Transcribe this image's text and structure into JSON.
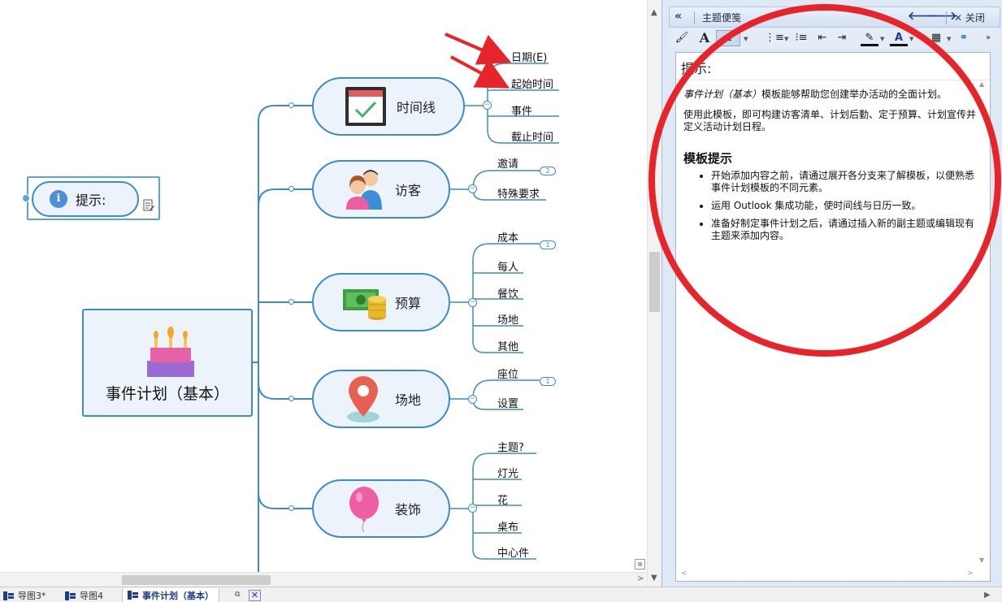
{
  "map": {
    "central": {
      "label": "事件计划（基本）",
      "icon": "birthday-cake-icon"
    },
    "tip": {
      "label": "提示:",
      "icon": "info-icon"
    },
    "branches": [
      {
        "label": "时间线",
        "icon": "calendar-check-icon",
        "children": [
          "日期(E)",
          "起始时间",
          "事件",
          "截止时间"
        ]
      },
      {
        "label": "访客",
        "icon": "people-icon",
        "children": [
          "邀请",
          "特殊要求"
        ],
        "badge": "2"
      },
      {
        "label": "预算",
        "icon": "money-coins-icon",
        "children": [
          "成本",
          "每人",
          "餐饮",
          "场地",
          "其他"
        ],
        "badge": "1"
      },
      {
        "label": "场地",
        "icon": "map-pin-icon",
        "children": [
          "座位",
          "设置"
        ],
        "badge": "1"
      },
      {
        "label": "装饰",
        "icon": "balloon-icon",
        "children": [
          "主题?",
          "灯光",
          "花",
          "桌布",
          "中心件"
        ]
      }
    ]
  },
  "tabs": [
    {
      "label": "导图3*",
      "active": false
    },
    {
      "label": "导图4",
      "active": false
    },
    {
      "label": "事件计划（基本）",
      "active": true
    }
  ],
  "panel": {
    "title": "主题便笺",
    "close_label": "关闭",
    "note_title": "提示:",
    "intro_em": "事件计划（基本）",
    "intro_rest": "模板能够帮助您创建举办活动的全面计划。",
    "para2": "使用此模板，即可构建访客清单、计划后勤、定于预算、计划宣传并定义活动计划日程。",
    "section_heading": "模板提示",
    "bullets": [
      "开始添加内容之前，请通过展开各分支来了解模板，以便熟悉事件计划模板的不同元素。",
      "运用 Outlook 集成功能，使时间线与日历一致。",
      "准备好制定事件计划之后，请通过插入新的副主题或编辑现有主题来添加内容。"
    ]
  },
  "colors": {
    "accent": "#3d8cc6",
    "annotation_red": "#e8242b",
    "node_fill": "#edf3fb"
  }
}
